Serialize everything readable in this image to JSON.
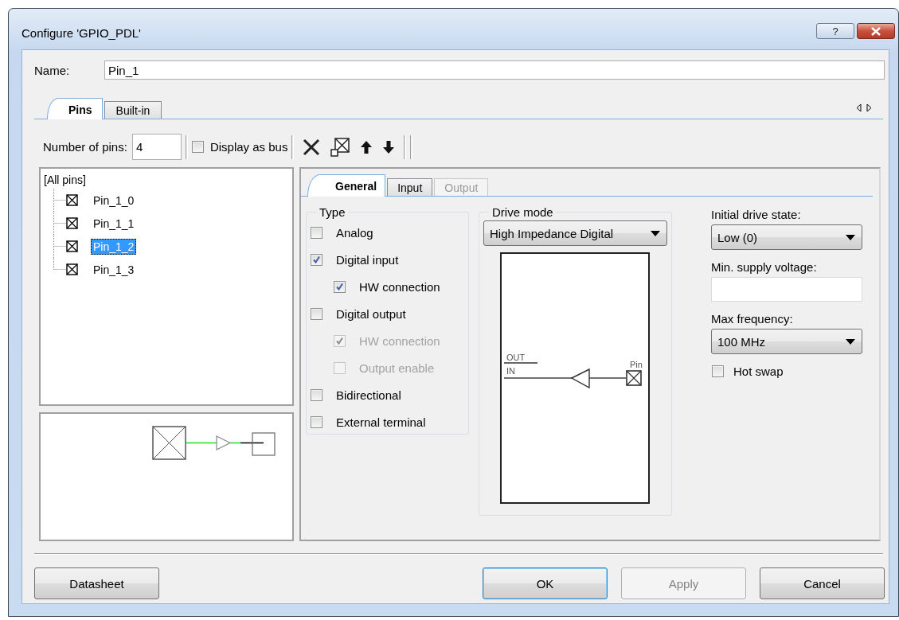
{
  "window": {
    "title": "Configure 'GPIO_PDL'",
    "help_button": "?"
  },
  "name": {
    "label": "Name:",
    "value": "Pin_1"
  },
  "tabs": [
    {
      "label": "Pins",
      "selected": true
    },
    {
      "label": "Built-in",
      "selected": false
    }
  ],
  "toolbar": {
    "pins_label": "Number of pins:",
    "pins_value": "4",
    "display_as_bus": {
      "label": "Display as bus",
      "checked": false
    }
  },
  "tree": {
    "root": "[All pins]",
    "children": [
      {
        "label": "Pin_1_0",
        "selected": false
      },
      {
        "label": "Pin_1_1",
        "selected": false
      },
      {
        "label": "Pin_1_2",
        "selected": true
      },
      {
        "label": "Pin_1_3",
        "selected": false
      }
    ]
  },
  "pin_tabs": [
    {
      "label": "General",
      "selected": true,
      "disabled": false
    },
    {
      "label": "Input",
      "selected": false,
      "disabled": false
    },
    {
      "label": "Output",
      "selected": false,
      "disabled": true
    }
  ],
  "type_group": {
    "title": "Type",
    "options": [
      {
        "label": "Analog",
        "checked": false,
        "disabled": false
      },
      {
        "label": "Digital input",
        "checked": true,
        "disabled": false,
        "children": [
          {
            "label": "HW connection",
            "checked": true,
            "disabled": false
          }
        ]
      },
      {
        "label": "Digital output",
        "checked": false,
        "disabled": false,
        "children": [
          {
            "label": "HW connection",
            "checked": true,
            "disabled": true
          },
          {
            "label": "Output enable",
            "checked": false,
            "disabled": true
          }
        ]
      },
      {
        "label": "Bidirectional",
        "checked": false,
        "disabled": false
      },
      {
        "label": "External terminal",
        "checked": false,
        "disabled": false
      }
    ]
  },
  "drive_mode": {
    "title": "Drive mode",
    "value": "High Impedance Digital",
    "diagram": {
      "out_label": "OUT",
      "in_label": "IN",
      "pin_label": "Pin"
    }
  },
  "settings": [
    {
      "kind": "select",
      "label": "Initial drive state:",
      "value": "Low (0)"
    },
    {
      "kind": "input",
      "label": "Min. supply voltage:"
    },
    {
      "kind": "select",
      "label": "Max frequency:",
      "value": "100 MHz"
    },
    {
      "kind": "checkbox",
      "label": "Hot swap",
      "checked": false
    }
  ],
  "buttons": [
    {
      "label": "Datasheet",
      "default": false,
      "disabled": false
    },
    {
      "label": "OK",
      "default": true,
      "disabled": false
    },
    {
      "label": "Apply",
      "default": false,
      "disabled": true
    },
    {
      "label": "Cancel",
      "default": false,
      "disabled": false
    }
  ]
}
